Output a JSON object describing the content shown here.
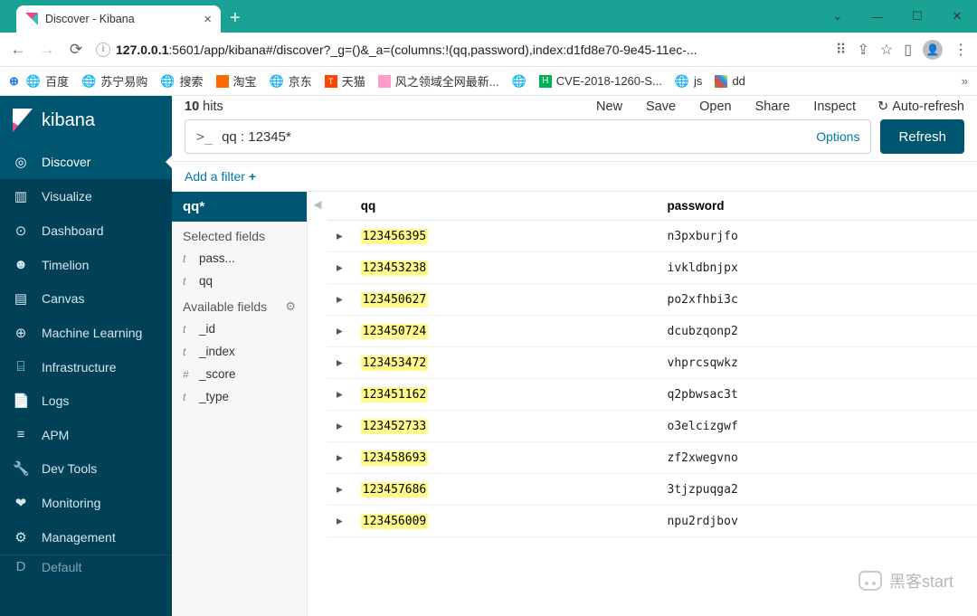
{
  "window": {
    "title": "Discover - Kibana"
  },
  "address": {
    "url_host": "127.0.0.1",
    "url_rest": ":5601/app/kibana#/discover?_g=()&_a=(columns:!(qq,password),index:d1fd8e70-9e45-11ec-..."
  },
  "bookmarks": [
    {
      "label": "百度",
      "icon": "globe"
    },
    {
      "label": "苏宁易购",
      "icon": "globe"
    },
    {
      "label": "搜索",
      "icon": "globe"
    },
    {
      "label": "淘宝",
      "icon": "orange"
    },
    {
      "label": "京东",
      "icon": "globe"
    },
    {
      "label": "天猫",
      "icon": "tm",
      "iconText": "T"
    },
    {
      "label": "风之领域全网最新...",
      "icon": "pink"
    },
    {
      "label": "",
      "icon": "globe"
    },
    {
      "label": "CVE-2018-1260-S...",
      "icon": "green",
      "iconText": "H"
    },
    {
      "label": "js",
      "icon": "globe"
    },
    {
      "label": "dd",
      "icon": "multi"
    }
  ],
  "brand": "kibana",
  "nav": [
    {
      "label": "Discover",
      "icon": "◎",
      "active": true
    },
    {
      "label": "Visualize",
      "icon": "▥"
    },
    {
      "label": "Dashboard",
      "icon": "⊙"
    },
    {
      "label": "Timelion",
      "icon": "☻"
    },
    {
      "label": "Canvas",
      "icon": "▤"
    },
    {
      "label": "Machine Learning",
      "icon": "⊕"
    },
    {
      "label": "Infrastructure",
      "icon": "⌸"
    },
    {
      "label": "Logs",
      "icon": "📄"
    },
    {
      "label": "APM",
      "icon": "≡"
    },
    {
      "label": "Dev Tools",
      "icon": "🔧"
    },
    {
      "label": "Monitoring",
      "icon": "❤"
    },
    {
      "label": "Management",
      "icon": "⚙"
    },
    {
      "label": "Default",
      "icon": "D"
    }
  ],
  "discover": {
    "hits_count": "10",
    "hits_label": "hits",
    "actions": {
      "new": "New",
      "save": "Save",
      "open": "Open",
      "share": "Share",
      "inspect": "Inspect",
      "autorefresh": "Auto-refresh"
    },
    "query": "qq : 12345*",
    "options_label": "Options",
    "refresh_label": "Refresh",
    "add_filter": "Add a filter",
    "index_pattern": "qq*",
    "selected_fields_label": "Selected fields",
    "available_fields_label": "Available fields",
    "selected_fields": [
      {
        "type": "t",
        "name": "pass..."
      },
      {
        "type": "t",
        "name": "qq"
      }
    ],
    "available_fields": [
      {
        "type": "t",
        "name": "_id"
      },
      {
        "type": "t",
        "name": "_index"
      },
      {
        "type": "#",
        "name": "_score"
      },
      {
        "type": "t",
        "name": "_type"
      }
    ],
    "columns": {
      "qq": "qq",
      "password": "password"
    },
    "rows": [
      {
        "qq": "123456395",
        "password": "n3pxburjfo"
      },
      {
        "qq": "123453238",
        "password": "ivkldbnjpx"
      },
      {
        "qq": "123450627",
        "password": "po2xfhbi3c"
      },
      {
        "qq": "123450724",
        "password": "dcubzqonp2"
      },
      {
        "qq": "123453472",
        "password": "vhprcsqwkz"
      },
      {
        "qq": "123451162",
        "password": "q2pbwsac3t"
      },
      {
        "qq": "123452733",
        "password": "o3elcizgwf"
      },
      {
        "qq": "123458693",
        "password": "zf2xwegvno"
      },
      {
        "qq": "123457686",
        "password": "3tjzpuqga2"
      },
      {
        "qq": "123456009",
        "password": "npu2rdjbov"
      }
    ]
  },
  "watermark": "黑客start"
}
